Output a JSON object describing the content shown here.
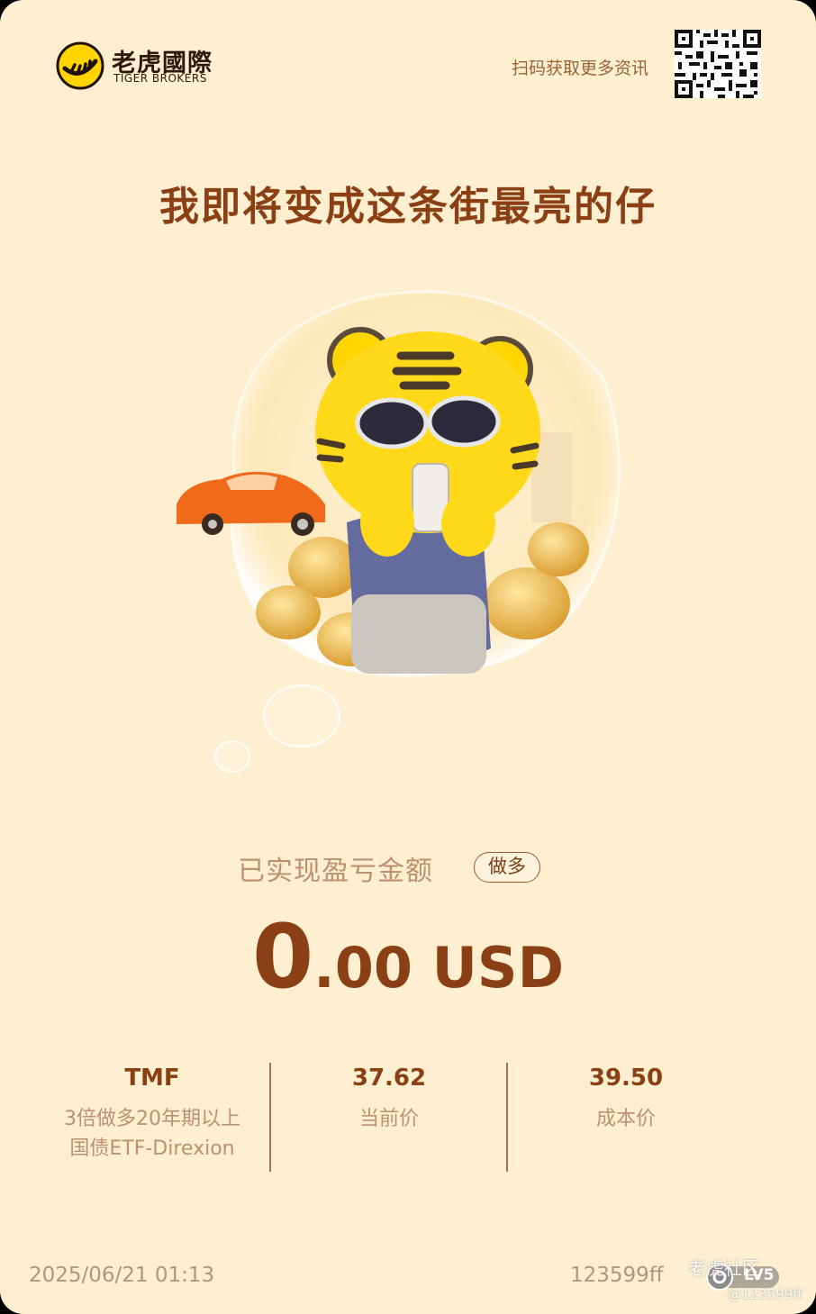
{
  "header": {
    "brand_cn": "老虎國際",
    "brand_en": "TIGER BROKERS",
    "scan_text": "扫码获取更多资讯"
  },
  "slogan": "我即将变成这条街最亮的仔",
  "pnl": {
    "label": "已实现盈亏金额",
    "side": "做多",
    "value_int": "0",
    "value_rest": ".00 USD"
  },
  "stats": [
    {
      "value": "TMF",
      "label_line1": "3倍做多20年期以上",
      "label_line2": "国债ETF-Direxion"
    },
    {
      "value": "37.62",
      "label_line1": "当前价",
      "label_line2": ""
    },
    {
      "value": "39.50",
      "label_line1": "成本价",
      "label_line2": ""
    }
  ],
  "footer": {
    "datetime": "2025/06/21 01:13",
    "user_id": "123599ff",
    "watermark": "老虎社区",
    "watermark_id": "@123599ff",
    "level": "LV5"
  },
  "colors": {
    "background": "#fdefcf",
    "primary_brown": "#8a3f14",
    "muted_label": "#bb9170",
    "tiger_yellow": "#ffd400"
  },
  "icons": {
    "logo": "tiger-logo-icon",
    "qr": "qr-code-icon",
    "level": "level-badge-icon"
  }
}
